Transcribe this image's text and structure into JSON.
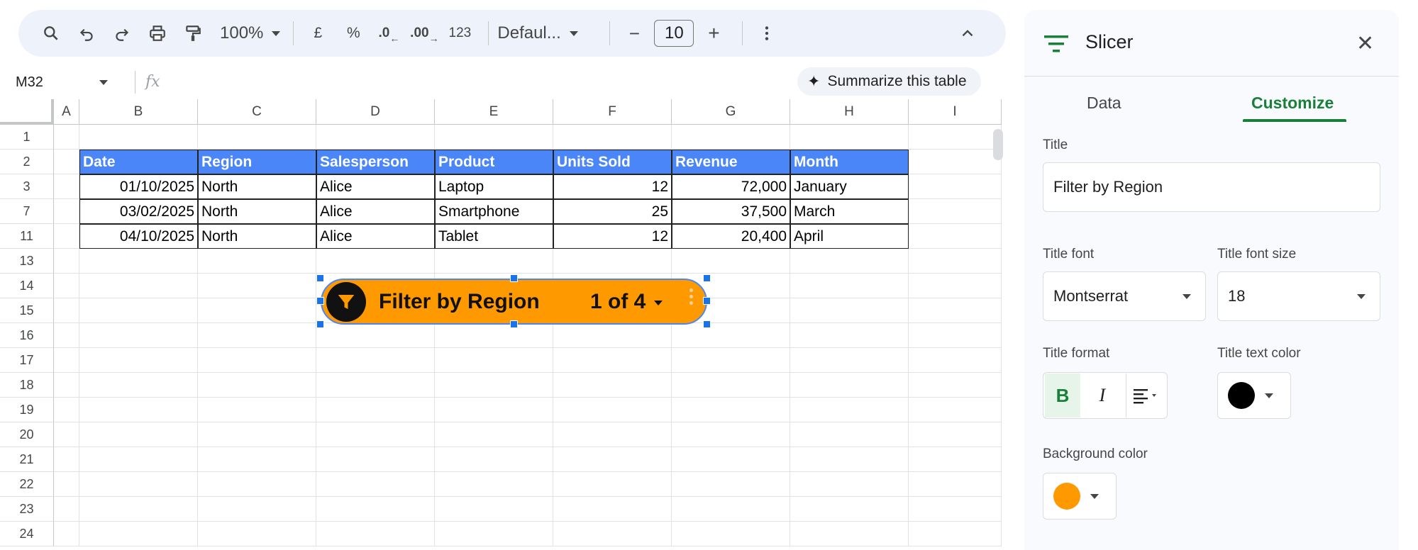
{
  "toolbar": {
    "zoom": "100%",
    "currency": "£",
    "percent": "%",
    "dec_decrease": ".0",
    "dec_increase": ".00",
    "number_format": "123",
    "font": "Defaul...",
    "font_size": "10",
    "minus": "−",
    "plus": "+"
  },
  "formula_bar": {
    "cell_ref": "M32",
    "fx": "fx",
    "summarize_label": "Summarize this table"
  },
  "grid": {
    "columns": [
      "A",
      "B",
      "C",
      "D",
      "E",
      "F",
      "G",
      "H",
      "I"
    ],
    "rows": [
      "1",
      "2",
      "3",
      "7",
      "11",
      "13",
      "14",
      "15",
      "16",
      "17",
      "18",
      "19",
      "20",
      "21",
      "22",
      "23",
      "24"
    ],
    "headers": [
      "Date",
      "Region",
      "Salesperson",
      "Product",
      "Units Sold",
      "Revenue",
      "Month"
    ],
    "data": [
      [
        "01/10/2025",
        "North",
        "Alice",
        "Laptop",
        "12",
        "72,000",
        "January"
      ],
      [
        "03/02/2025",
        "North",
        "Alice",
        "Smartphone",
        "25",
        "37,500",
        "March"
      ],
      [
        "04/10/2025",
        "North",
        "Alice",
        "Tablet",
        "12",
        "20,400",
        "April"
      ]
    ]
  },
  "slicer": {
    "title": "Filter by Region",
    "count": "1 of 4",
    "background": "#ff9900"
  },
  "panel": {
    "title": "Slicer",
    "tabs": [
      "Data",
      "Customize"
    ],
    "active_tab": "Customize",
    "title_label": "Title",
    "title_value": "Filter by Region",
    "title_font_label": "Title font",
    "title_font_value": "Montserrat",
    "title_font_size_label": "Title font size",
    "title_font_size_value": "18",
    "title_format_label": "Title format",
    "bold": "B",
    "italic": "I",
    "title_text_color_label": "Title text color",
    "title_text_color": "#000000",
    "background_color_label": "Background color",
    "background_color": "#ff9900",
    "accent": "#188038"
  }
}
